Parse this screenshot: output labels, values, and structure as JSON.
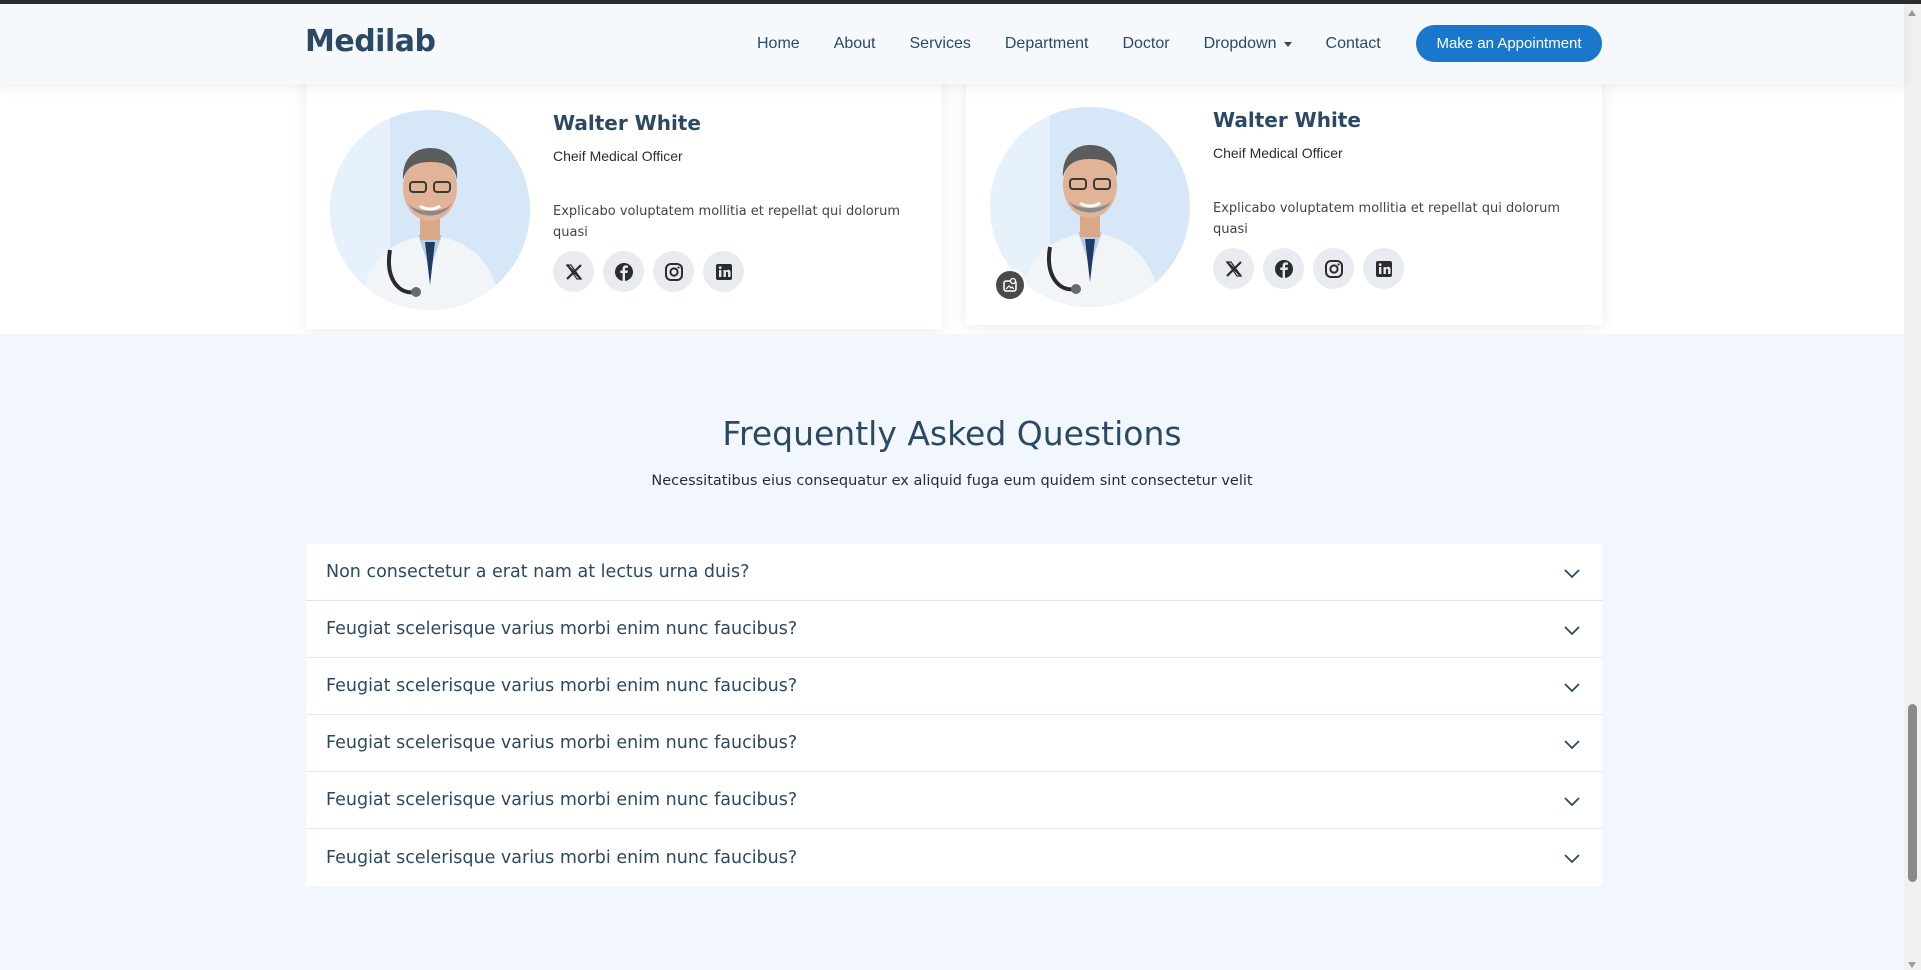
{
  "header": {
    "logo": "Medilab",
    "nav": [
      {
        "label": "Home"
      },
      {
        "label": "About"
      },
      {
        "label": "Services"
      },
      {
        "label": "Department"
      },
      {
        "label": "Doctor"
      },
      {
        "label": "Dropdown",
        "has_caret": true
      },
      {
        "label": "Contact"
      }
    ],
    "cta_label": "Make an Appointment"
  },
  "doctors": [
    {
      "name": "Walter White",
      "role": "Cheif Medical Officer",
      "description": "Explicabo voluptatem mollitia et repellat qui dolorum quasi",
      "socials": [
        "x-icon",
        "facebook-icon",
        "instagram-icon",
        "linkedin-icon"
      ]
    },
    {
      "name": "Walter White",
      "role": "Cheif Medical Officer",
      "description": "Explicabo voluptatem mollitia et repellat qui dolorum quasi",
      "socials": [
        "x-icon",
        "facebook-icon",
        "instagram-icon",
        "linkedin-icon"
      ]
    }
  ],
  "faq": {
    "title": "Frequently Asked Questions",
    "subtitle": "Necessitatibus eius consequatur ex aliquid fuga eum quidem sint consectetur velit",
    "items": [
      {
        "question": "Non consectetur a erat nam at lectus urna duis?"
      },
      {
        "question": "Feugiat scelerisque varius morbi enim nunc faucibus?"
      },
      {
        "question": "Feugiat scelerisque varius morbi enim nunc faucibus?"
      },
      {
        "question": "Feugiat scelerisque varius morbi enim nunc faucibus?"
      },
      {
        "question": "Feugiat scelerisque varius morbi enim nunc faucibus?"
      },
      {
        "question": "Feugiat scelerisque varius morbi enim nunc faucibus?"
      }
    ]
  },
  "colors": {
    "heading": "#2c4964",
    "accent": "#1977cc",
    "faq_background": "#f1f7fd"
  }
}
